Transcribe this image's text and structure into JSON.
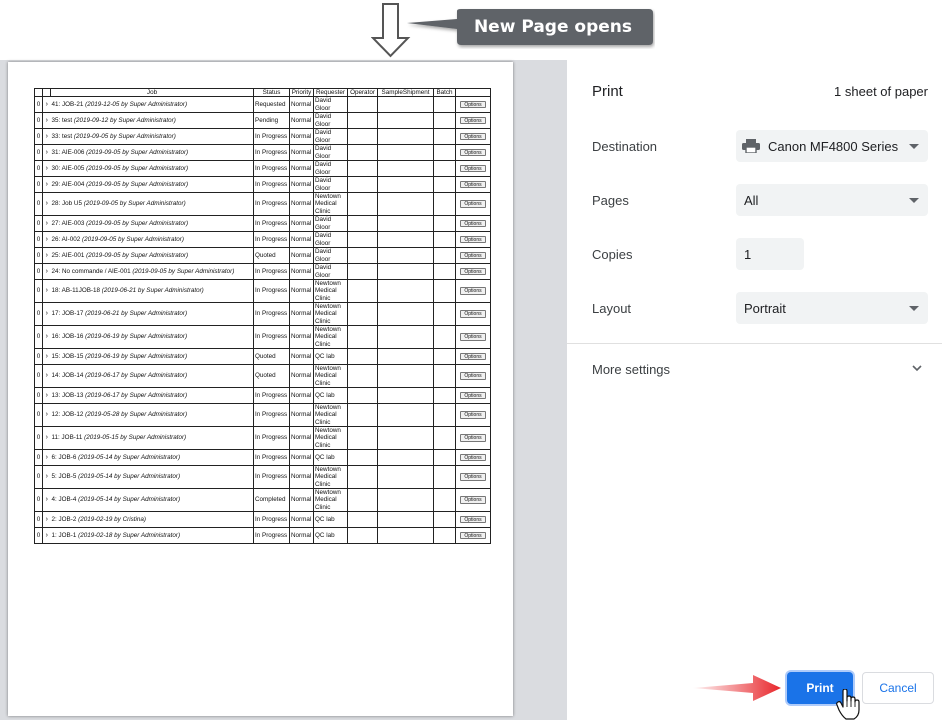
{
  "annotation": {
    "callout_text": "New Page opens"
  },
  "preview": {
    "table": {
      "headers": [
        "",
        "",
        "Job",
        "Status",
        "Priority",
        "Requester",
        "Operator",
        "SampleShipment",
        "Batch",
        ""
      ],
      "rows": [
        {
          "count": "0",
          "name": "41: JOB-21",
          "meta": "(2019-12-05 by Super Administrator)",
          "status": "Requested",
          "priority": "Normal",
          "requester": "David Gloor",
          "option": "Options"
        },
        {
          "count": "0",
          "name": "35: test",
          "meta": "(2019-09-12 by Super Administrator)",
          "status": "Pending",
          "priority": "Normal",
          "requester": "David Gloor",
          "option": "Options"
        },
        {
          "count": "0",
          "name": "33: test",
          "meta": "(2019-09-05 by Super Administrator)",
          "status": "In Progress",
          "priority": "Normal",
          "requester": "David Gloor",
          "option": "Options"
        },
        {
          "count": "0",
          "name": "31: AIE-006",
          "meta": "(2019-09-05 by Super Administrator)",
          "status": "In Progress",
          "priority": "Normal",
          "requester": "David Gloor",
          "option": "Options"
        },
        {
          "count": "0",
          "name": "30: AIE-005",
          "meta": "(2019-09-05 by Super Administrator)",
          "status": "In Progress",
          "priority": "Normal",
          "requester": "David Gloor",
          "option": "Options"
        },
        {
          "count": "0",
          "name": "29: AIE-004",
          "meta": "(2019-09-05 by Super Administrator)",
          "status": "In Progress",
          "priority": "Normal",
          "requester": "David Gloor",
          "option": "Options"
        },
        {
          "count": "0",
          "name": "28: Job U5",
          "meta": "(2019-09-05 by Super Administrator)",
          "status": "In Progress",
          "priority": "Normal",
          "requester": "Newtown Medical Clinic",
          "option": "Options"
        },
        {
          "count": "0",
          "name": "27: AIE-003",
          "meta": "(2019-09-05 by Super Administrator)",
          "status": "In Progress",
          "priority": "Normal",
          "requester": "David Gloor",
          "option": "Options"
        },
        {
          "count": "0",
          "name": "26: AI-002",
          "meta": "(2019-09-05 by Super Administrator)",
          "status": "In Progress",
          "priority": "Normal",
          "requester": "David Gloor",
          "option": "Options"
        },
        {
          "count": "0",
          "name": "25: AIE-001",
          "meta": "(2019-09-05 by Super Administrator)",
          "status": "Quoted",
          "priority": "Normal",
          "requester": "David Gloor",
          "option": "Options"
        },
        {
          "count": "0",
          "name": "24: No commande / AIE-001",
          "meta": "(2019-09-05 by Super Administrator)",
          "status": "In Progress",
          "priority": "Normal",
          "requester": "David Gloor",
          "option": "Options"
        },
        {
          "count": "0",
          "name": "18: AB-11JOB-18",
          "meta": "(2019-06-21 by Super Administrator)",
          "status": "In Progress",
          "priority": "Normal",
          "requester": "Newtown Medical Clinic",
          "option": "Options"
        },
        {
          "count": "0",
          "name": "17: JOB-17",
          "meta": "(2019-06-21 by Super Administrator)",
          "status": "In Progress",
          "priority": "Normal",
          "requester": "Newtown Medical Clinic",
          "option": "Options"
        },
        {
          "count": "0",
          "name": "16: JOB-16",
          "meta": "(2019-06-19 by Super Administrator)",
          "status": "In Progress",
          "priority": "Normal",
          "requester": "Newtown Medical Clinic",
          "option": "Options"
        },
        {
          "count": "0",
          "name": "15: JOB-15",
          "meta": "(2019-06-19 by Super Administrator)",
          "status": "Quoted",
          "priority": "Normal",
          "requester": "QC lab",
          "option": "Options"
        },
        {
          "count": "0",
          "name": "14: JOB-14",
          "meta": "(2019-06-17 by Super Administrator)",
          "status": "Quoted",
          "priority": "Normal",
          "requester": "Newtown Medical Clinic",
          "option": "Options"
        },
        {
          "count": "0",
          "name": "13: JOB-13",
          "meta": "(2019-06-17 by Super Administrator)",
          "status": "In Progress",
          "priority": "Normal",
          "requester": "QC lab",
          "option": "Options"
        },
        {
          "count": "0",
          "name": "12: JOB-12",
          "meta": "(2019-05-28 by Super Administrator)",
          "status": "In Progress",
          "priority": "Normal",
          "requester": "Newtown Medical Clinic",
          "option": "Options"
        },
        {
          "count": "0",
          "name": "11: JOB-11",
          "meta": "(2019-05-15 by Super Administrator)",
          "status": "In Progress",
          "priority": "Normal",
          "requester": "Newtown Medical Clinic",
          "option": "Options"
        },
        {
          "count": "0",
          "name": "6: JOB-6",
          "meta": "(2019-05-14 by Super Administrator)",
          "status": "In Progress",
          "priority": "Normal",
          "requester": "QC lab",
          "option": "Options"
        },
        {
          "count": "0",
          "name": "5: JOB-5",
          "meta": "(2019-05-14 by Super Administrator)",
          "status": "In Progress",
          "priority": "Normal",
          "requester": "Newtown Medical Clinic",
          "option": "Options"
        },
        {
          "count": "0",
          "name": "4: JOB-4",
          "meta": "(2019-05-14 by Super Administrator)",
          "status": "Completed",
          "priority": "Normal",
          "requester": "Newtown Medical Clinic",
          "option": "Options"
        },
        {
          "count": "0",
          "name": "2: JOB-2",
          "meta": "(2019-02-19 by Cristina)",
          "status": "In Progress",
          "priority": "Normal",
          "requester": "QC lab",
          "option": "Options"
        },
        {
          "count": "0",
          "name": "1: JOB-1",
          "meta": "(2019-02-18 by Super Administrator)",
          "status": "In Progress",
          "priority": "Normal",
          "requester": "QC lab",
          "option": "Options"
        }
      ]
    }
  },
  "settings": {
    "title": "Print",
    "sheets": "1 sheet of paper",
    "destination": {
      "label": "Destination",
      "value": "Canon MF4800 Series",
      "icon": "printer-icon"
    },
    "pages": {
      "label": "Pages",
      "value": "All"
    },
    "copies": {
      "label": "Copies",
      "value": "1"
    },
    "layout": {
      "label": "Layout",
      "value": "Portrait"
    },
    "more_settings": "More settings",
    "print_button": "Print",
    "cancel_button": "Cancel"
  },
  "colors": {
    "accent": "#1a73e8",
    "callout_bg": "#5f6368",
    "pointer_arrow": "#e8262b"
  }
}
